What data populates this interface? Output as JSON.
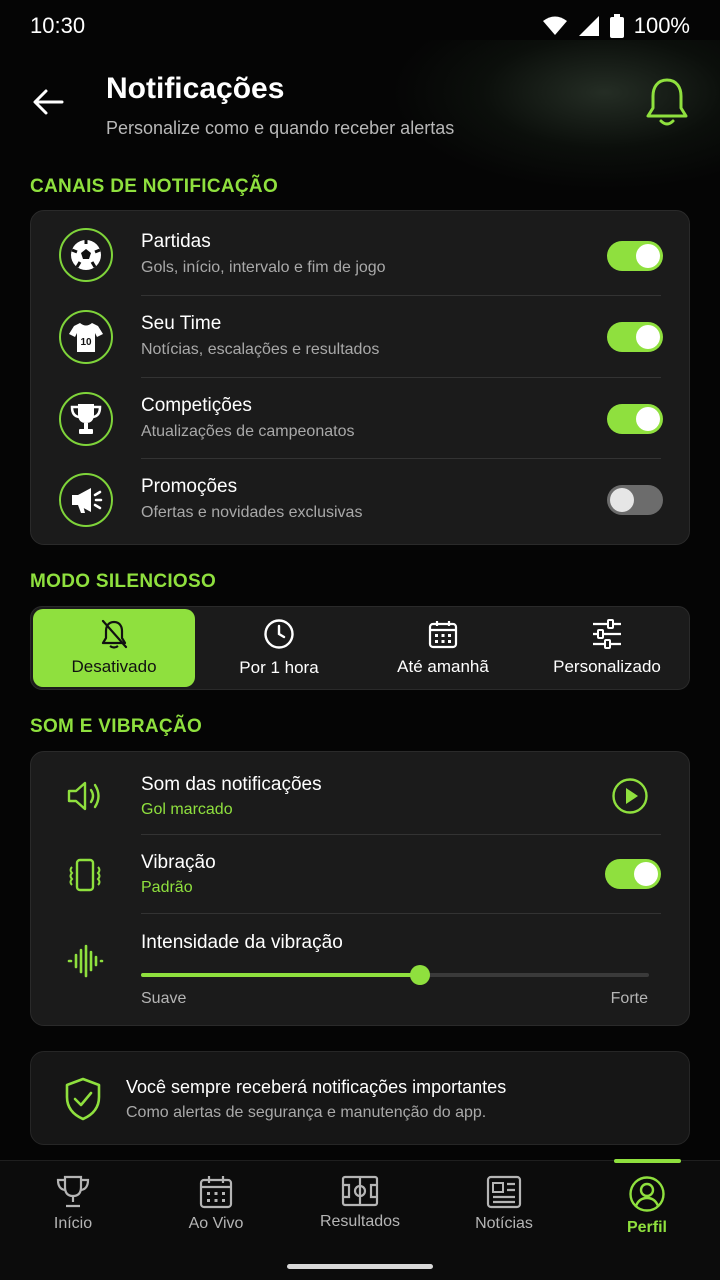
{
  "status_bar": {
    "time": "10:30",
    "battery": "100%",
    "icons": [
      "wifi-icon",
      "signal-icon",
      "battery-icon"
    ]
  },
  "header": {
    "title": "Notificações",
    "subtitle": "Personalize como e quando receber alertas"
  },
  "colors": {
    "accent": "#8fe03e",
    "background": "#050505",
    "card": "#1b1b1b"
  },
  "channels": {
    "section_title": "CANAIS DE NOTIFICAÇÃO",
    "items": [
      {
        "icon": "soccer-ball-icon",
        "name": "Partidas",
        "desc": "Gols, início, intervalo e fim de jogo",
        "enabled": true
      },
      {
        "icon": "jersey-icon",
        "name": "Seu Time",
        "desc": "Notícias, escalações e resultados",
        "enabled": true,
        "jersey_number": "10"
      },
      {
        "icon": "trophy-icon",
        "name": "Competições",
        "desc": "Atualizações de campeonatos",
        "enabled": true
      },
      {
        "icon": "megaphone-icon",
        "name": "Promoções",
        "desc": "Ofertas e novidades exclusivas",
        "enabled": false
      }
    ]
  },
  "silent_mode": {
    "section_title": "MODO SILENCIOSO",
    "selected": "Desativado",
    "options": [
      {
        "icon": "bell-off-icon",
        "label": "Desativado"
      },
      {
        "icon": "clock-icon",
        "label": "Por 1 hora"
      },
      {
        "icon": "calendar-icon",
        "label": "Até amanhã"
      },
      {
        "icon": "sliders-icon",
        "label": "Personalizado"
      }
    ]
  },
  "sound": {
    "section_title": "SOM E VIBRAÇÃO",
    "notification_sound": {
      "label": "Som das notificações",
      "value": "Gol marcado"
    },
    "vibration": {
      "label": "Vibração",
      "value": "Padrão",
      "enabled": true
    },
    "intensity": {
      "label": "Intensidade da vibração",
      "min_label": "Suave",
      "max_label": "Forte",
      "level": 0.55
    }
  },
  "info": {
    "title": "Você sempre receberá notificações importantes",
    "desc": "Como alertas de segurança e manutenção do app."
  },
  "nav": {
    "active": "Perfil",
    "items": [
      {
        "icon": "trophy-icon",
        "label": "Início"
      },
      {
        "icon": "calendar-icon",
        "label": "Ao Vivo"
      },
      {
        "icon": "field-icon",
        "label": "Resultados"
      },
      {
        "icon": "newspaper-icon",
        "label": "Notícias"
      },
      {
        "icon": "profile-icon",
        "label": "Perfil"
      }
    ]
  }
}
